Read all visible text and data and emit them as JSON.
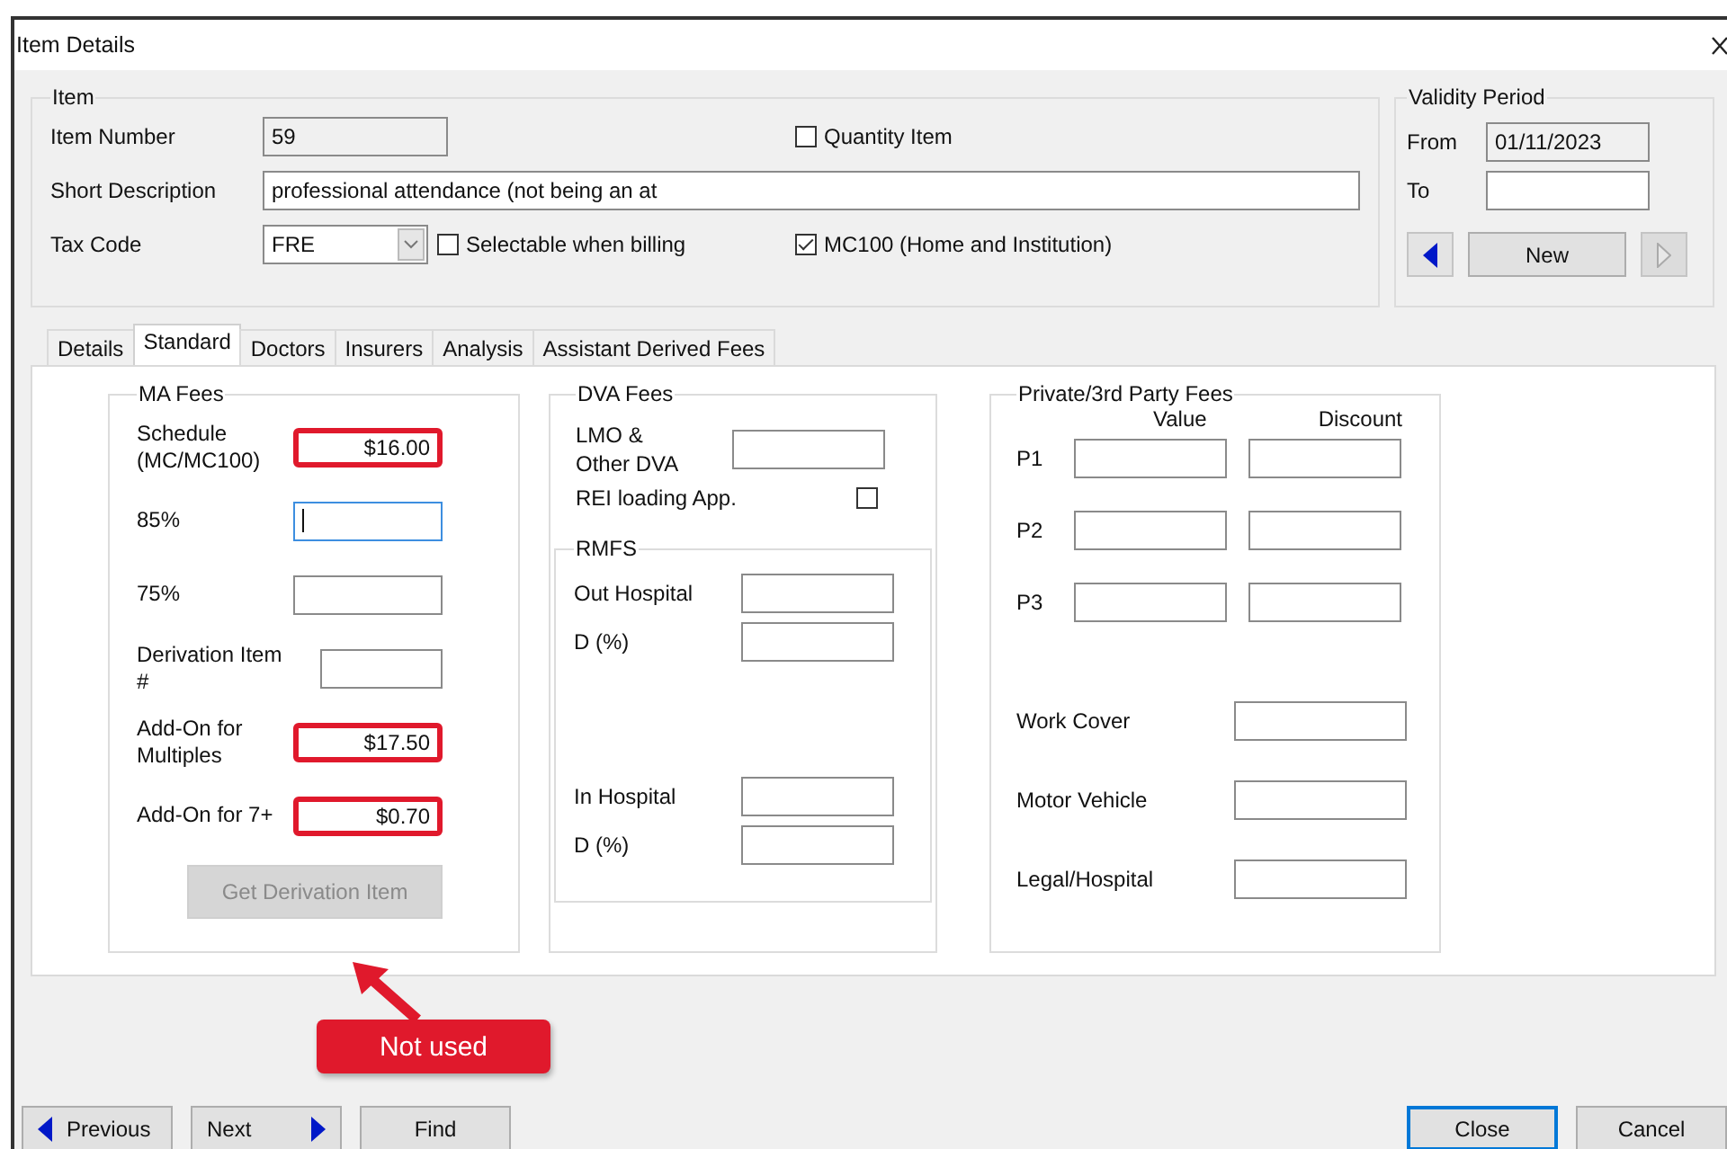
{
  "window": {
    "title": "Item Details"
  },
  "item_group": {
    "title": "Item",
    "item_number": {
      "label": "Item Number",
      "value": "59"
    },
    "quantity_item": {
      "label": "Quantity Item",
      "checked": false
    },
    "short_description": {
      "label": "Short Description",
      "value": "professional attendance (not being an at"
    },
    "tax_code": {
      "label": "Tax Code",
      "value": "FRE"
    },
    "selectable_when_billing": {
      "label": "Selectable when billing",
      "checked": false
    },
    "mc100": {
      "label": "MC100 (Home and Institution)",
      "checked": true
    }
  },
  "validity_period": {
    "title": "Validity Period",
    "from": {
      "label": "From",
      "value": "01/11/2023"
    },
    "to": {
      "label": "To"
    },
    "new_button": "New",
    "previous_disabled": false,
    "next_disabled": true
  },
  "tabs": [
    {
      "label": "Details",
      "selected": false
    },
    {
      "label": "Standard",
      "selected": true
    },
    {
      "label": "Doctors",
      "selected": false
    },
    {
      "label": "Insurers",
      "selected": false
    },
    {
      "label": "Analysis",
      "selected": false
    },
    {
      "label": "Assistant Derived Fees",
      "selected": false
    }
  ],
  "ma_fees": {
    "title": "MA Fees",
    "rows": [
      {
        "label": "Schedule (MC/MC100)",
        "value": "$16.00",
        "highlighted": true,
        "focused": false
      },
      {
        "label": "85%",
        "highlighted": false,
        "focused": true
      },
      {
        "label": "75%",
        "highlighted": false,
        "focused": false
      },
      {
        "label": "Derivation Item #",
        "highlighted": false,
        "focused": false
      },
      {
        "label": "Add-On for Multiples",
        "value": "$17.50",
        "highlighted": true,
        "focused": false
      },
      {
        "label": "Add-On for 7+",
        "value": "$0.70",
        "highlighted": true,
        "focused": false
      }
    ],
    "button": {
      "label": "Get Derivation Item",
      "disabled": true
    }
  },
  "dva_fees": {
    "title": "DVA Fees",
    "lmo": {
      "label": "LMO & Other DVA"
    },
    "rei_loading": {
      "label": "REI loading App.",
      "checked": false
    },
    "rmfs": {
      "title": "RMFS",
      "rows": [
        {
          "label": "Out Hospital"
        },
        {
          "label": "D (%)"
        },
        {
          "label": "In Hospital"
        },
        {
          "label": "D (%)"
        }
      ]
    }
  },
  "private_fees": {
    "title": "Private/3rd Party Fees",
    "columns": [
      "Value",
      "Discount"
    ],
    "rows": [
      {
        "label": "P1"
      },
      {
        "label": "P2"
      },
      {
        "label": "P3"
      }
    ],
    "other_rows": [
      {
        "label": "Work Cover"
      },
      {
        "label": "Motor Vehicle"
      },
      {
        "label": "Legal/Hospital"
      }
    ]
  },
  "callout": {
    "text": "Not used"
  },
  "buttons_left": [
    {
      "label": "Previous",
      "kind": "back"
    },
    {
      "label": "Next",
      "kind": "forward"
    },
    {
      "label": "Find",
      "kind": "plain"
    }
  ],
  "buttons_right": [
    {
      "label": "Close",
      "default": true
    },
    {
      "label": "Cancel",
      "default": false
    }
  ]
}
